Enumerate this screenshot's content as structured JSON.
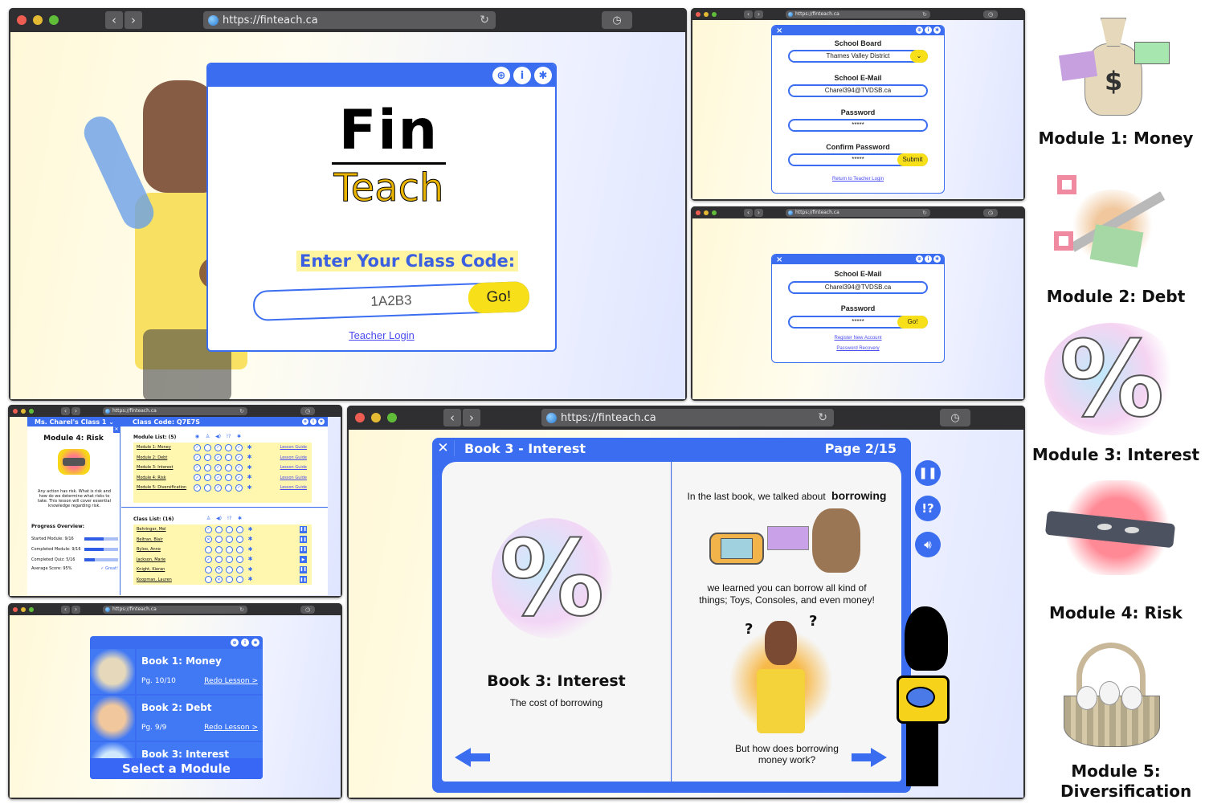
{
  "browser": {
    "url": "https://finteach.ca"
  },
  "login_window": {
    "logo_top": "Fin",
    "logo_bottom": "Teach",
    "prompt": "Enter Your Class Code:",
    "class_code_value": "1A2B3",
    "go_label": "Go!",
    "teacher_login_link": "Teacher Login",
    "header_icons": [
      "globe-icon",
      "info-icon",
      "gear-icon"
    ]
  },
  "register_window": {
    "close_icon": "×",
    "school_board_label": "School Board",
    "school_board_value": "Thames Valley District",
    "email_label": "School E-Mail",
    "email_value": "Charel394@TVDSB.ca",
    "password_label": "Password",
    "password_value": "*****",
    "confirm_label": "Confirm Password",
    "confirm_value": "*****",
    "submit_label": "Submit",
    "return_link": "Return to Teacher Login"
  },
  "teacher_login_window": {
    "email_label": "School E-Mail",
    "email_value": "Charel394@TVDSB.ca",
    "password_label": "Password",
    "password_value": "*****",
    "go_label": "Go!",
    "register_link": "Register New Account",
    "recovery_link": "Password Recovery"
  },
  "dashboard_window": {
    "class_selector": "Ms. Charel's Class 1",
    "class_code": "Class Code: Q7E7S",
    "module_title": "Module 4: Risk",
    "module_description": "Any action has risk. What is risk and how do we determine what risks to take. This lesson will cover essential knowledge regarding risk.",
    "progress_title": "Progress Overview:",
    "progress": [
      {
        "label": "Started Module: 9/16",
        "fraction": 0.5625
      },
      {
        "label": "Completed Module: 9/16",
        "fraction": 0.5625
      },
      {
        "label": "Completed Quiz: 5/16",
        "fraction": 0.3125
      }
    ],
    "average_score": "Average Score: 95%",
    "average_badge": "✓ Great!",
    "module_list_title": "Module List: (5)",
    "module_columns": [
      "eye-icon",
      "mic-icon",
      "speaker-icon",
      "hint-icon",
      "settings-icon"
    ],
    "modules": [
      {
        "name": "Module 1: Money",
        "checks": [
          true,
          false,
          true,
          false,
          true
        ],
        "guide": "Lesson Guide"
      },
      {
        "name": "Module 2: Debt",
        "checks": [
          true,
          false,
          true,
          false,
          true
        ],
        "guide": "Lesson Guide"
      },
      {
        "name": "Module 3: Interest",
        "checks": [
          true,
          false,
          true,
          false,
          true
        ],
        "guide": "Lesson Guide"
      },
      {
        "name": "Module 4: Risk",
        "checks": [
          true,
          false,
          true,
          false,
          true
        ],
        "guide": "Lesson Guide"
      },
      {
        "name": "Module 5: Diversification",
        "checks": [
          true,
          false,
          true,
          false,
          true
        ],
        "guide": "Lesson Guide"
      }
    ],
    "class_list_title": "Class List: (16)",
    "class_columns": [
      "mic-icon",
      "speaker-icon",
      "hint-icon",
      "settings-icon"
    ],
    "students": [
      {
        "name": "Behringer, Mel",
        "marks": [
          "check",
          "",
          "",
          ""
        ],
        "state": "pause"
      },
      {
        "name": "Beltran, Blair",
        "marks": [
          "x",
          "",
          "",
          ""
        ],
        "state": "pause"
      },
      {
        "name": "Byloo, Anne",
        "marks": [
          "",
          "",
          "",
          ""
        ],
        "state": "pause"
      },
      {
        "name": "Jackson, Marie",
        "marks": [
          "check",
          "",
          "",
          ""
        ],
        "state": "play"
      },
      {
        "name": "Knight, Kieran",
        "marks": [
          "",
          "x",
          "",
          ""
        ],
        "state": "pause"
      },
      {
        "name": "Koopman, Lauren",
        "marks": [
          "",
          "x",
          "",
          ""
        ],
        "state": "pause"
      }
    ]
  },
  "module_select_window": {
    "books": [
      {
        "title": "Book 1: Money",
        "pages": "Pg. 10/10",
        "action": "Redo Lesson >"
      },
      {
        "title": "Book 2: Debt",
        "pages": "Pg. 9/9",
        "action": "Redo Lesson >"
      },
      {
        "title": "Book 3: Interest",
        "pages": "",
        "action": ""
      }
    ],
    "footer": "Select a Module"
  },
  "book_window": {
    "title": "Book 3 - Interest",
    "page_indicator": "Page 2/15",
    "left_heading": "Book 3: Interest",
    "left_subtitle": "The cost of borrowing",
    "right_line1": "In the last book, we talked about",
    "right_line1_bold": "borrowing",
    "right_line2": "we learned you can borrow all kind of things; Toys, Consoles, and even money!",
    "right_line3": "But how does borrowing money work?",
    "side_buttons": [
      "pause-icon",
      "hint-icon",
      "speaker-icon"
    ],
    "hint_label": "!?"
  },
  "module_gallery": [
    {
      "caption": "Module 1: Money",
      "icon": "money-bag-icon"
    },
    {
      "caption": "Module 2:  Debt",
      "icon": "scissors-icon"
    },
    {
      "caption": "Module 3: Interest",
      "icon": "percent-icon"
    },
    {
      "caption": "Module 4: Risk",
      "icon": "mask-icon"
    },
    {
      "caption": "Module 5: Diversification",
      "icon": "egg-basket-icon"
    }
  ]
}
